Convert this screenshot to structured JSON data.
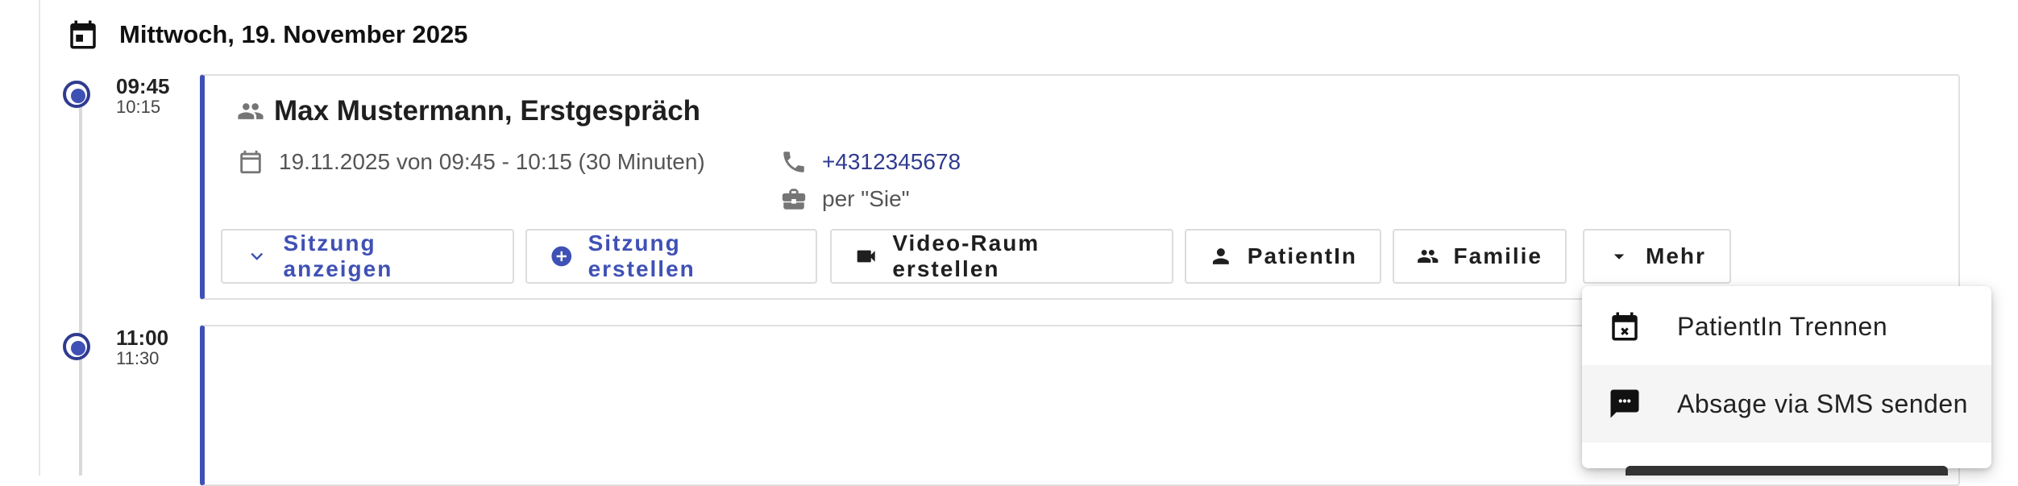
{
  "header": {
    "date": "Mittwoch, 19. November 2025"
  },
  "appointments": [
    {
      "start": "09:45",
      "end": "10:15",
      "title": "Max Mustermann, Erstgespräch",
      "date_range": "19.11.2025 von 09:45 - 10:15 (30 Minuten)",
      "phone": "+4312345678",
      "address_form": "per \"Sie\"",
      "buttons": [
        {
          "label": "Sitzung anzeigen",
          "icon": "chevron-down-icon"
        },
        {
          "label": "Sitzung erstellen",
          "icon": "add-circle-icon"
        },
        {
          "label": "Video-Raum erstellen",
          "icon": "videocam-icon"
        },
        {
          "label": "PatientIn",
          "icon": "person-icon"
        },
        {
          "label": "Familie",
          "icon": "people-icon"
        },
        {
          "label": "Mehr",
          "icon": "caret-down-icon"
        }
      ]
    },
    {
      "start": "11:00",
      "end": "11:30"
    }
  ],
  "menu": {
    "items": [
      {
        "label": "PatientIn Trennen",
        "icon": "calendar-remove-icon"
      },
      {
        "label": "Absage via SMS senden",
        "icon": "sms-icon"
      }
    ]
  },
  "colors": {
    "accent": "#3f51b5",
    "accent_dark": "#2f3b8f",
    "phone": "#2f3b8f"
  }
}
